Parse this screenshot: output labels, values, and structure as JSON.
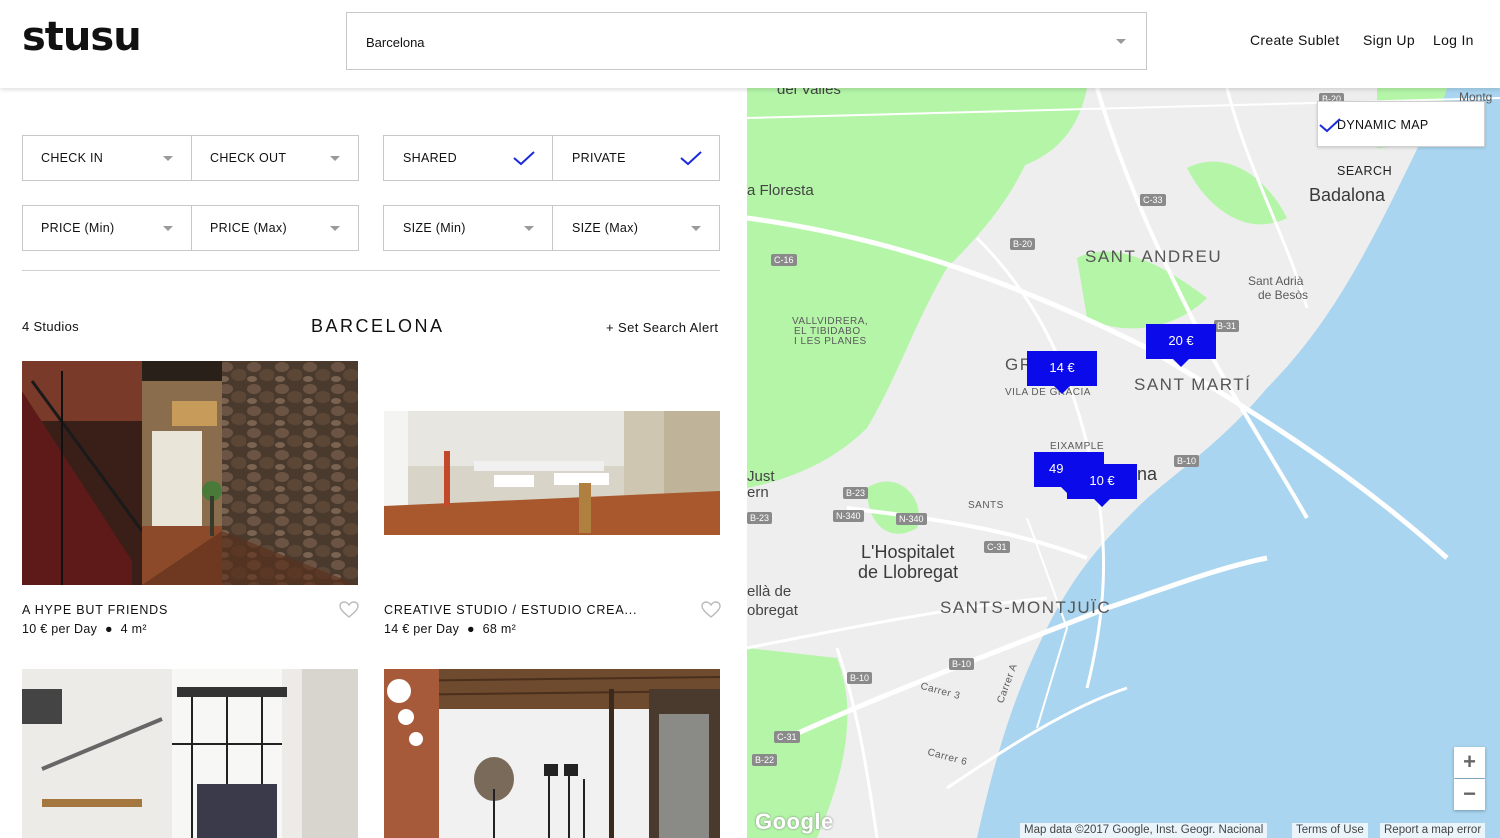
{
  "header": {
    "logo": "stusu",
    "city_value": "Barcelona",
    "nav": {
      "create": "Create Sublet",
      "signup": "Sign Up",
      "login": "Log In"
    }
  },
  "filters": {
    "check_in": "CHECK IN",
    "check_out": "CHECK OUT",
    "shared": "SHARED",
    "private": "PRIVATE",
    "price_min": "PRICE (Min)",
    "price_max": "PRICE (Max)",
    "size_min": "SIZE (Min)",
    "size_max": "SIZE (Max)",
    "shared_checked": true,
    "private_checked": true
  },
  "results": {
    "count": "4 Studios",
    "title": "BARCELONA",
    "alert": "+ Set Search Alert",
    "listings": [
      {
        "title": "A HYPE BUT FRIENDS",
        "price": "10 € per Day",
        "size": "4 m²"
      },
      {
        "title": "CREATIVE STUDIO / ESTUDIO CREA...",
        "price": "14 € per Day",
        "size": "68 m²"
      },
      {
        "title": "",
        "price": "",
        "size": ""
      },
      {
        "title": "",
        "price": "",
        "size": ""
      }
    ]
  },
  "map": {
    "dynamic_label": "DYNAMIC MAP",
    "dynamic_checked": true,
    "search_label": "SEARCH",
    "pins": [
      "14 €",
      "20 €",
      "49",
      "10 €"
    ],
    "labels": {
      "del_valles": "del Vallès",
      "floresta": "a Floresta",
      "badalona": "Badalona",
      "sant_andreu": "SANT ANDREU",
      "sant_adria": "Sant Adrià",
      "de_besos": "de Besòs",
      "vallvidrera1": "VALLVIDRERA,",
      "vallvidrera2": "EL TIBIDABO",
      "vallvidrera3": "I LES PLANES",
      "gr": "GR",
      "vila_de_gracia": "VILA DE GRÀCIA",
      "sant_marti": "SANT MARTÍ",
      "eixample": "EIXAMPLE",
      "na": "na",
      "just": "Just",
      "ern": "ern",
      "sants": "SANTS",
      "hospitalet1": "L'Hospitalet",
      "hospitalet2": "de Llobregat",
      "cornella1": "ellà de",
      "cornella2": "obregat",
      "sants_montjuic": "SANTS-MONTJUÏC",
      "montg": "Montg",
      "carrer3": "Carrer 3",
      "carrera": "Carrer A",
      "carrer6": "Carrer 6"
    },
    "roads": [
      "B-20",
      "C-33",
      "C-16",
      "B-20",
      "B-31",
      "B-10",
      "B-23",
      "N-340",
      "N-340",
      "B-23",
      "C-31",
      "B-10",
      "B-10",
      "C-31",
      "B-22"
    ],
    "zoom_in": "+",
    "zoom_out": "−",
    "google": "Google",
    "attribution": "Map data ©2017 Google, Inst. Geogr. Nacional",
    "terms": "Terms of Use",
    "report": "Report a map error"
  },
  "colors": {
    "pin": "#0a0aeb",
    "check": "#1a2bdb",
    "park": "#b4f5a8",
    "water": "#a9d5f0"
  }
}
